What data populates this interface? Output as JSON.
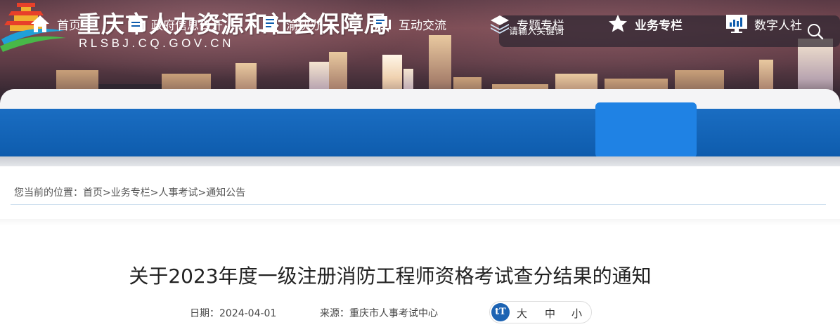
{
  "header": {
    "title": "重庆市人力资源和社会保障局",
    "domain": "RLSBJ.CQ.GOV.CN",
    "logo_icon": "temple-emblem-icon",
    "search": {
      "placeholder": "请输入关键词",
      "icon": "search-icon"
    }
  },
  "nav": {
    "items": [
      {
        "label": "首页",
        "icon": "home-icon"
      },
      {
        "label": "政府信息公开",
        "icon": "document-icon"
      },
      {
        "label": "渝快办",
        "icon": "book-icon"
      },
      {
        "label": "互动交流",
        "icon": "chat-icon"
      },
      {
        "label": "专题专栏",
        "icon": "layers-icon"
      },
      {
        "label": "业务专栏",
        "icon": "star-icon"
      },
      {
        "label": "数字人社",
        "icon": "monitor-chart-icon"
      }
    ],
    "active_index": 5
  },
  "breadcrumb": {
    "prefix": "您当前的位置：",
    "items": [
      "首页",
      "业务专栏",
      "人事考试",
      "通知公告"
    ],
    "separator": ">"
  },
  "article": {
    "title": "关于2023年度一级注册消防工程师资格考试查分结果的通知",
    "date_label": "日期：",
    "date": "2024-04-01",
    "source_label": "来源：",
    "source": "重庆市人事考试中心",
    "font_size": {
      "icon": "font-size-icon",
      "icon_text": "tT",
      "large": "大",
      "medium": "中",
      "small": "小"
    }
  },
  "colors": {
    "nav_bg": "#0e5cad",
    "nav_active": "#1f82e4",
    "text": "#222222"
  }
}
